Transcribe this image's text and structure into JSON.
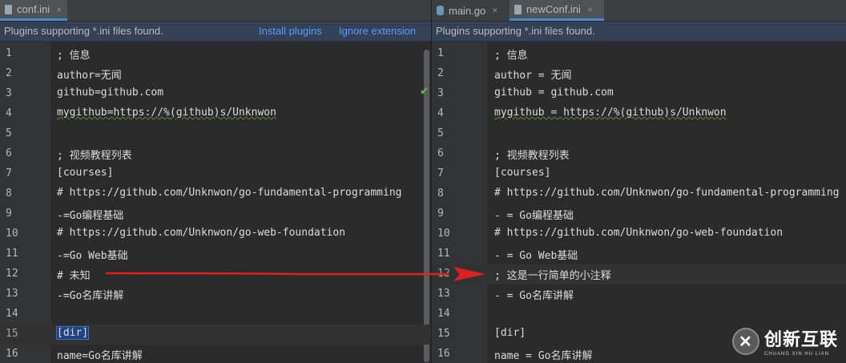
{
  "left": {
    "tabs": [
      {
        "label": "conf.ini",
        "icon": "ini-file-icon",
        "close": "×"
      }
    ],
    "banner": {
      "message": "Plugins supporting *.ini files found.",
      "install": "Install plugins",
      "ignore": "Ignore extension"
    },
    "lines": [
      {
        "n": "1",
        "t": "; 信息"
      },
      {
        "n": "2",
        "t": "author=无闻"
      },
      {
        "n": "3",
        "t": "github=github.com"
      },
      {
        "n": "4",
        "t": "mygithub=https://%(github)s/Unknwon"
      },
      {
        "n": "5",
        "t": ""
      },
      {
        "n": "6",
        "t": "; 视频教程列表"
      },
      {
        "n": "7",
        "t": "[courses]"
      },
      {
        "n": "8",
        "t": "# https://github.com/Unknwon/go-fundamental-programming"
      },
      {
        "n": "9",
        "t": "-=Go编程基础"
      },
      {
        "n": "10",
        "t": "# https://github.com/Unknwon/go-web-foundation"
      },
      {
        "n": "11",
        "t": "-=Go Web基础"
      },
      {
        "n": "12",
        "t": "# 未知"
      },
      {
        "n": "13",
        "t": "-=Go名库讲解"
      },
      {
        "n": "14",
        "t": ""
      },
      {
        "n": "15",
        "t": "[dir]"
      },
      {
        "n": "16",
        "t": "name=Go名库讲解"
      }
    ]
  },
  "right": {
    "tabs": [
      {
        "label": "main.go",
        "icon": "go-file-icon",
        "close": "×"
      },
      {
        "label": "newConf.ini",
        "icon": "ini-file-icon",
        "close": "×"
      }
    ],
    "banner": {
      "message": "Plugins supporting *.ini files found."
    },
    "lines": [
      {
        "n": "1",
        "t": "; 信息"
      },
      {
        "n": "2",
        "t": "author = 无闻"
      },
      {
        "n": "3",
        "t": "github = github.com"
      },
      {
        "n": "4",
        "t": "mygithub = https://%(github)s/Unknwon"
      },
      {
        "n": "5",
        "t": ""
      },
      {
        "n": "6",
        "t": "; 视频教程列表"
      },
      {
        "n": "7",
        "t": "[courses]"
      },
      {
        "n": "8",
        "t": "# https://github.com/Unknwon/go-fundamental-programming"
      },
      {
        "n": "9",
        "t": "- = Go编程基础"
      },
      {
        "n": "10",
        "t": "# https://github.com/Unknwon/go-web-foundation"
      },
      {
        "n": "11",
        "t": "- = Go Web基础"
      },
      {
        "n": "12",
        "t": "; 这是一行简单的小注释"
      },
      {
        "n": "13",
        "t": "- = Go名库讲解"
      },
      {
        "n": "14",
        "t": ""
      },
      {
        "n": "15",
        "t": "[dir]"
      },
      {
        "n": "16",
        "t": "name = Go名库讲解"
      }
    ]
  },
  "annotation": {
    "arrow_color": "#e02020"
  },
  "watermark": {
    "name": "创新互联",
    "sub": "CHUANG XIN HU LIAN",
    "mark": "✕"
  }
}
